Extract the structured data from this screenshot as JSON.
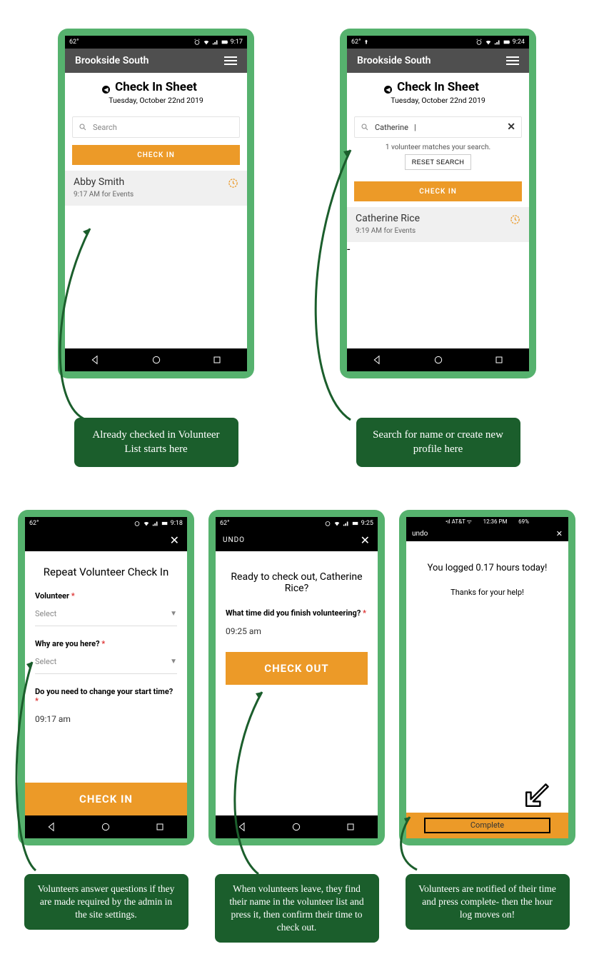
{
  "phone1": {
    "temp": "62°",
    "time": "9:17",
    "appbar": "Brookside South",
    "title": "Check In Sheet",
    "date": "Tuesday, October 22nd 2019",
    "search_placeholder": "Search",
    "checkin": "CHECK IN",
    "vol_name": "Abby Smith",
    "vol_sub": "9:17 AM  for Events"
  },
  "phone2": {
    "temp": "62°",
    "time": "9:24",
    "appbar": "Brookside South",
    "title": "Check In Sheet",
    "date": "Tuesday, October 22nd 2019",
    "search_value": "Catherine",
    "match_text": "1 volunteer matches your search.",
    "reset": "RESET SEARCH",
    "checkin": "CHECK IN",
    "vol_name": "Catherine Rice",
    "vol_sub": "9:19 AM  for Events"
  },
  "phone3": {
    "temp": "62°",
    "time": "9:18",
    "title": "Repeat Volunteer Check In",
    "f1_label": "Volunteer",
    "f1_value": "Select",
    "f2_label": "Why are you here?",
    "f2_value": "Select",
    "f3_label": "Do you need to change your start time?",
    "f3_value": "09:17 am",
    "action": "CHECK IN"
  },
  "phone4": {
    "temp": "62°",
    "time": "9:25",
    "undo": "UNDO",
    "title": "Ready to check out, Catherine Rice?",
    "q_label": "What time did you finish volunteering?",
    "q_value": "09:25 am",
    "action": "CHECK OUT"
  },
  "phone5": {
    "carrier": "•ıl AT&T ᯤ",
    "time": "12:36 PM",
    "batt": "69%",
    "undo": "undo",
    "logged": "You logged 0.17 hours today!",
    "thanks": "Thanks for your help!",
    "complete": "Complete"
  },
  "callouts": {
    "c1": "Already checked in Volunteer List starts here",
    "c2": "Search for name or create new profile here",
    "c3": "Volunteers answer questions if they are made required by the admin in the site settings.",
    "c4": "When volunteers leave, they find their name in the volunteer list and press it, then confirm their time to check out.",
    "c5": "Volunteers are notified of their time and press complete- then the hour log moves on!"
  }
}
